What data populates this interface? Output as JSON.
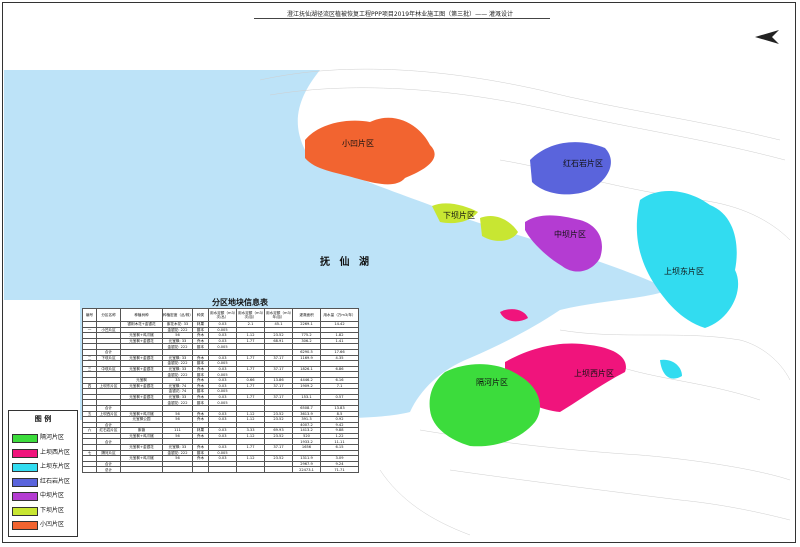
{
  "title": "澄江抚仙湖径流区植被恢复工程PPP项目2019年林业施工图（第三批）—— 灌溉设计",
  "lake_name": "抚 仙 湖",
  "zones": [
    {
      "name": "小凹片区",
      "color": "#f26430"
    },
    {
      "name": "下坝片区",
      "color": "#c8e632"
    },
    {
      "name": "中坝片区",
      "color": "#b43cd2"
    },
    {
      "name": "红石岩片区",
      "color": "#5a64dc"
    },
    {
      "name": "上坝东片区",
      "color": "#32dcf0"
    },
    {
      "name": "上坝西片区",
      "color": "#f0147c"
    },
    {
      "name": "隔河片区",
      "color": "#3cdc3c"
    }
  ],
  "legend": {
    "title": "图 例",
    "items": [
      {
        "label": "隔河片区",
        "color": "#3cdc3c"
      },
      {
        "label": "上坝西片区",
        "color": "#f0147c"
      },
      {
        "label": "上坝东片区",
        "color": "#32dcf0"
      },
      {
        "label": "红石岩片区",
        "color": "#5a64dc"
      },
      {
        "label": "中坝片区",
        "color": "#b43cd2"
      },
      {
        "label": "下坝片区",
        "color": "#c8e632"
      },
      {
        "label": "小凹片区",
        "color": "#f26430"
      }
    ]
  },
  "table": {
    "title": "分区地块信息表",
    "headers": [
      "编号",
      "分区名称",
      "种植树种",
      "种植密度（丛/株）",
      "种类",
      "用水定额（m3/次/丛）",
      "用水定额（m3/次/亩）",
      "用水定额（m3/年/亩）",
      "灌溉面积",
      "用水量（万m3/年）"
    ],
    "rows": [
      [
        "",
        "",
        "银荆木花+金银花",
        "紫花木花: 33",
        "林果",
        "0.03",
        "2.1",
        "45.1",
        "2269.1",
        "14.42"
      ],
      [
        "一",
        "小凹片区",
        "",
        "金银花: 222",
        "藤本",
        "0.005",
        "",
        "",
        "",
        ""
      ],
      [
        "",
        "",
        "元宝枫+鸡爪槭",
        "56",
        "乔木",
        "0.03",
        "1.12",
        "23.52",
        "775.2",
        "1.82"
      ],
      [
        "",
        "",
        "元宝枫+金银花",
        "元宝枫: 33",
        "乔木",
        "0.03",
        "1.77",
        "68.91",
        "306.2",
        "1.41"
      ],
      [
        "",
        "",
        "",
        "金银花: 222",
        "藤本",
        "0.005",
        "",
        "",
        "",
        ""
      ],
      [
        "",
        "合计",
        "",
        "",
        "",
        "",
        "",
        "",
        "6290.5",
        "17.66"
      ],
      [
        "二",
        "下坝片区",
        "元宝枫+金银花",
        "元宝枫: 33",
        "乔木",
        "0.03",
        "1.77",
        "37.17",
        "1169.9",
        "4.35"
      ],
      [
        "",
        "",
        "",
        "金银花: 222",
        "藤本",
        "0.005",
        "",
        "",
        "",
        ""
      ],
      [
        "三",
        "中坝片区",
        "元宝枫+金银花",
        "元宝枫: 33",
        "乔木",
        "0.03",
        "1.77",
        "37.17",
        "1826.1",
        "6.86"
      ],
      [
        "",
        "",
        "",
        "金银花: 222",
        "藤本",
        "0.005",
        "",
        "",
        "",
        ""
      ],
      [
        "",
        "",
        "元宝枫",
        "33",
        "乔木",
        "0.03",
        "0.66",
        "13.86",
        "4446.2",
        "6.16"
      ],
      [
        "四",
        "上坝东片区",
        "元宝枫+金银花",
        "元宝枫: 74",
        "乔木",
        "0.03",
        "1.77",
        "37.17",
        "1909.2",
        "7.1"
      ],
      [
        "",
        "",
        "",
        "金银花: 74",
        "藤本",
        "0.005",
        "",
        "",
        "",
        ""
      ],
      [
        "",
        "",
        "元宝枫+金银花",
        "元宝枫: 33",
        "乔木",
        "0.03",
        "1.77",
        "37.17",
        "153.1",
        "0.57"
      ],
      [
        "",
        "",
        "",
        "金银花: 222",
        "藤本",
        "0.005",
        "",
        "",
        "",
        ""
      ],
      [
        "",
        "合计",
        "",
        "",
        "",
        "",
        "",
        "",
        "6508.7",
        "13.83"
      ],
      [
        "五",
        "上坝西片区",
        "元宝枫+鸡爪槭",
        "56",
        "乔木",
        "0.03",
        "1.12",
        "23.52",
        "3613.9",
        "8.5"
      ],
      [
        "",
        "",
        "元宝枫公园",
        "56",
        "乔木",
        "0.03",
        "1.12",
        "23.52",
        "391.3",
        "0.92"
      ],
      [
        "",
        "合计",
        "",
        "",
        "",
        "",
        "",
        "",
        "4007.2",
        "9.42"
      ],
      [
        "六",
        "红石岩片区",
        "紫薇",
        "111",
        "林果",
        "0.03",
        "3.33",
        "69.93",
        "1413.2",
        "9.88"
      ],
      [
        "",
        "",
        "元宝枫+鸡爪槭",
        "56",
        "乔木",
        "0.03",
        "1.12",
        "23.52",
        "520",
        "1.22"
      ],
      [
        "",
        "合计",
        "",
        "",
        "",
        "",
        "",
        "",
        "1933.2",
        "11.11"
      ],
      [
        "",
        "",
        "元宝枫+金银花",
        "元宝枫: 33",
        "乔木",
        "0.03",
        "1.77",
        "37.17",
        "1656",
        "6.15"
      ],
      [
        "七",
        "隔河片区",
        "",
        "金银花: 222",
        "藤本",
        "0.005",
        "",
        "",
        "",
        ""
      ],
      [
        "",
        "",
        "元宝枫+鸡爪槭",
        "56",
        "乔木",
        "0.03",
        "1.12",
        "23.52",
        "1311.9",
        "3.09"
      ],
      [
        "",
        "合计",
        "",
        "",
        "",
        "",
        "",
        "",
        "2967.9",
        "9.24"
      ],
      [
        "",
        "总计",
        "",
        "",
        "",
        "",
        "",
        "",
        "22473.1",
        "71.71"
      ]
    ]
  }
}
